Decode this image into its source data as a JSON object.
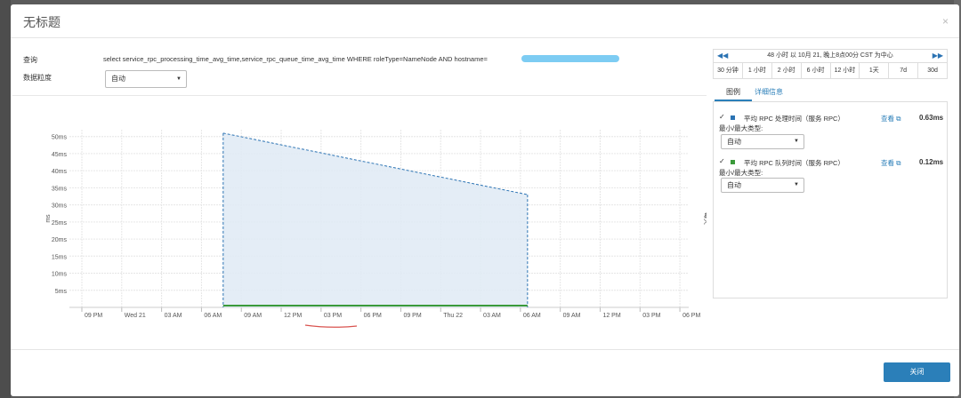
{
  "dialog": {
    "title": "无标题",
    "close_icon": "×"
  },
  "query": {
    "label": "查询",
    "text": "select service_rpc_processing_time_avg_time,service_rpc_queue_time_avg_time WHERE roleType=NameNode AND hostname="
  },
  "granularity": {
    "label": "数据粒度",
    "value": "自动"
  },
  "time_nav": {
    "title": "48 小时 以 10月 21, 晚上8点00分 CST 为中心",
    "prev_icon": "◀◀",
    "next_icon": "▶▶",
    "ranges": [
      "30 分钟",
      "1 小时",
      "2 小时",
      "6 小时",
      "12 小时",
      "1天",
      "7d",
      "30d"
    ]
  },
  "tabs": {
    "legend": "图例",
    "detail": "详细信息"
  },
  "series": [
    {
      "check": "✓",
      "name": "平均 RPC 处理时间（服务 RPC）",
      "view": "查看 ⧉",
      "value": "0.63ms",
      "minmax_label": "最小/最大类型:",
      "minmax_value": "自动",
      "color": "#2b73b3"
    },
    {
      "check": "✓",
      "name": "平均 RPC 队列时间（服务 RPC）",
      "view": "查看 ⧉",
      "value": "0.12ms",
      "minmax_label": "最小/最大类型:",
      "minmax_value": "自动",
      "color": "#3a9a3a"
    }
  ],
  "chart_data": {
    "type": "area",
    "ylabel": "ms",
    "right_label": "每天",
    "y_ticks": [
      "5ms",
      "10ms",
      "15ms",
      "20ms",
      "25ms",
      "30ms",
      "35ms",
      "40ms",
      "45ms",
      "50ms"
    ],
    "ylim": [
      0,
      52
    ],
    "x_ticks": [
      "09 PM",
      "Wed 21",
      "03 AM",
      "06 AM",
      "09 AM",
      "12 PM",
      "03 PM",
      "06 PM",
      "09 PM",
      "Thu 22",
      "03 AM",
      "06 AM",
      "09 AM",
      "12 PM",
      "03 PM",
      "06 PM"
    ],
    "series": [
      {
        "x": [
          "06 AM",
          "06 AM"
        ],
        "y": [
          51,
          33
        ],
        "color": "#2b73b3"
      },
      {
        "x": [
          "06 AM",
          "06 AM"
        ],
        "y": [
          0.12,
          0.12
        ],
        "color": "#3a9a3a"
      }
    ]
  },
  "footer": {
    "close_label": "关闭"
  }
}
